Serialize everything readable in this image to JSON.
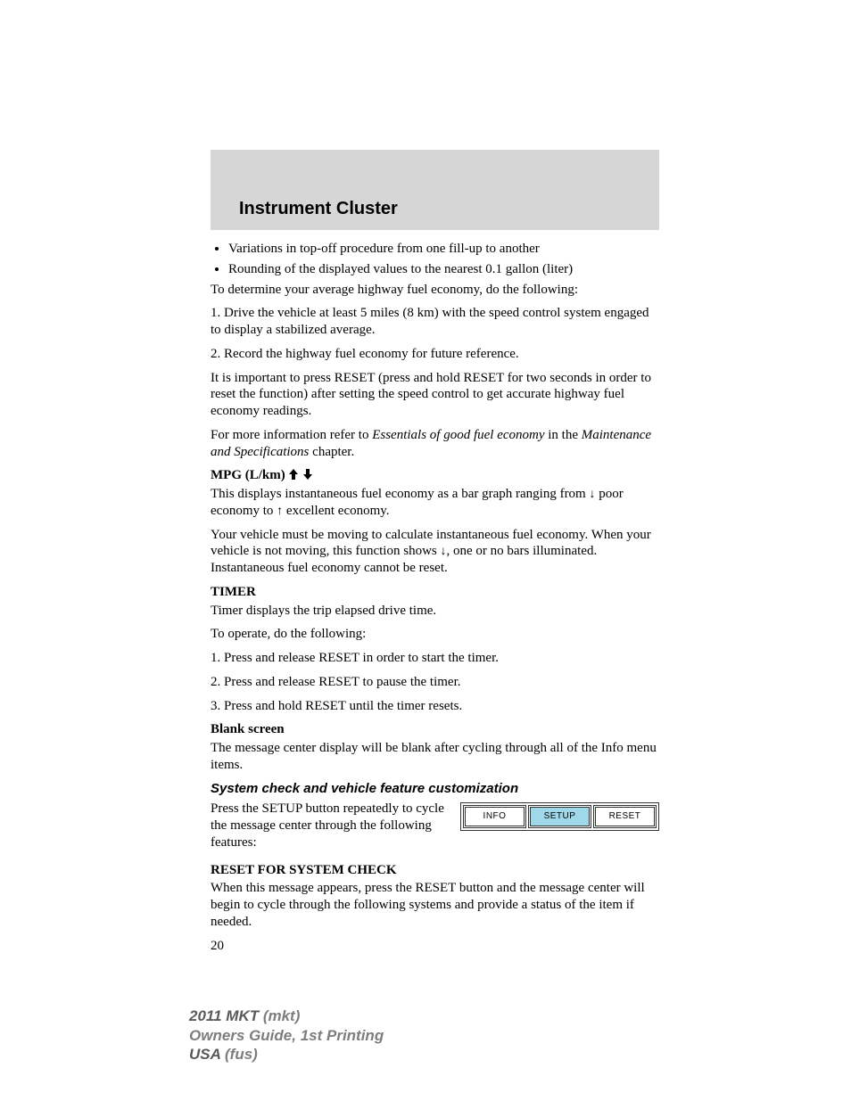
{
  "header": {
    "title": "Instrument Cluster"
  },
  "bullets": [
    "Variations in top-off procedure from one fill-up to another",
    "Rounding of the displayed values to the nearest 0.1 gallon (liter)"
  ],
  "p_determine": "To determine your average highway fuel economy, do the following:",
  "p_step1": "1. Drive the vehicle at least 5 miles (8 km) with the speed control system engaged to display a stabilized average.",
  "p_step2": "2. Record the highway fuel economy for future reference.",
  "p_important": "It is important to press RESET (press and hold RESET for two seconds in order to reset the function) after setting the speed control to get accurate highway fuel economy readings.",
  "p_moreinfo_a": "For more information refer to ",
  "p_moreinfo_b": "Essentials of good fuel economy",
  "p_moreinfo_c": " in the ",
  "p_moreinfo_d": "Maintenance and Specifications",
  "p_moreinfo_e": " chapter.",
  "mpg_label": "MPG (L/km)",
  "p_mpg1_a": "This displays instantaneous fuel economy as a bar graph ranging from ",
  "p_mpg1_b": " poor economy to ",
  "p_mpg1_c": " excellent economy.",
  "p_mpg2_a": "Your vehicle must be moving to calculate instantaneous fuel economy. When your vehicle is not moving, this function shows ",
  "p_mpg2_b": ", one or no bars illuminated. Instantaneous fuel economy cannot be reset.",
  "h_timer": "TIMER",
  "p_timer1": "Timer displays the trip elapsed drive time.",
  "p_timer2": "To operate, do the following:",
  "p_timer3": "1. Press and release RESET in order to start the timer.",
  "p_timer4": "2. Press and release RESET to pause the timer.",
  "p_timer5": "3. Press and hold RESET until the timer resets.",
  "h_blank": "Blank screen",
  "p_blank": "The message center display will be blank after cycling through all of the Info menu items.",
  "h_system": "System check and vehicle feature customization",
  "p_system": "Press the SETUP button repeatedly to cycle the message center through the following features:",
  "buttons": {
    "info": "INFO",
    "setup": "SETUP",
    "reset": "RESET"
  },
  "h_reset": "RESET FOR SYSTEM CHECK",
  "p_reset": "When this message appears, press the RESET button and the message center will begin to cycle through the following systems and provide a status of the item if needed.",
  "page_num": "20",
  "footer": {
    "l1a": "2011 MKT ",
    "l1b": "(mkt)",
    "l2": "Owners Guide, 1st Printing",
    "l3a": "USA ",
    "l3b": "(fus)"
  }
}
